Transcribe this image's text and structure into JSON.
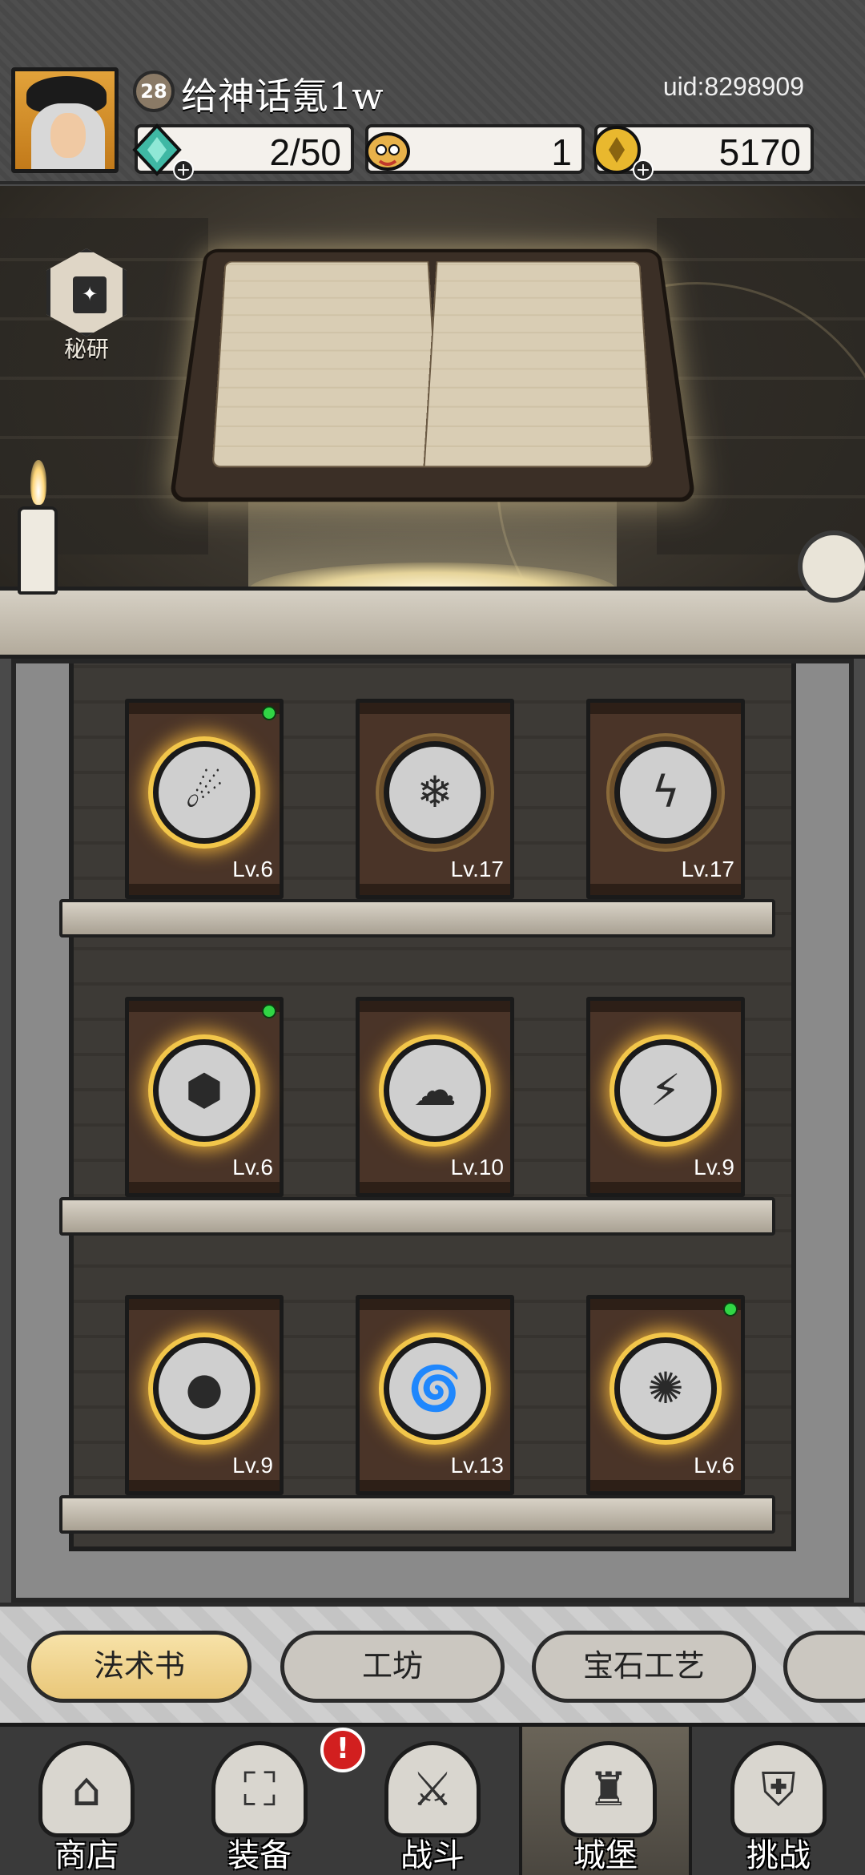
{
  "player": {
    "level": "28",
    "name": "给神话氪1w",
    "uid": "uid:8298909"
  },
  "resources": {
    "energy": "2/50",
    "tickets": "1",
    "gold": "5170"
  },
  "study": {
    "secret_label": "秘研"
  },
  "spellbooks": [
    {
      "level": "Lv.6",
      "emblem": "☄",
      "glow": true,
      "new": true
    },
    {
      "level": "Lv.17",
      "emblem": "❄",
      "glow": false,
      "new": false
    },
    {
      "level": "Lv.17",
      "emblem": "ϟ",
      "glow": false,
      "new": false
    },
    {
      "level": "Lv.6",
      "emblem": "⬢",
      "glow": true,
      "new": true
    },
    {
      "level": "Lv.10",
      "emblem": "☁",
      "glow": true,
      "new": false
    },
    {
      "level": "Lv.9",
      "emblem": "⚡",
      "glow": true,
      "new": false
    },
    {
      "level": "Lv.9",
      "emblem": "●",
      "glow": true,
      "new": false
    },
    {
      "level": "Lv.13",
      "emblem": "🌀",
      "glow": true,
      "new": false
    },
    {
      "level": "Lv.6",
      "emblem": "✺",
      "glow": true,
      "new": true
    }
  ],
  "subtabs": [
    "法术书",
    "工坊",
    "宝石工艺"
  ],
  "nav": [
    {
      "label": "商店",
      "icon": "⌂"
    },
    {
      "label": "装备",
      "icon": "⛶"
    },
    {
      "label": "战斗",
      "icon": "⚔"
    },
    {
      "label": "城堡",
      "icon": "♜"
    },
    {
      "label": "挑战",
      "icon": "⛨"
    }
  ],
  "nav_alert": "!"
}
